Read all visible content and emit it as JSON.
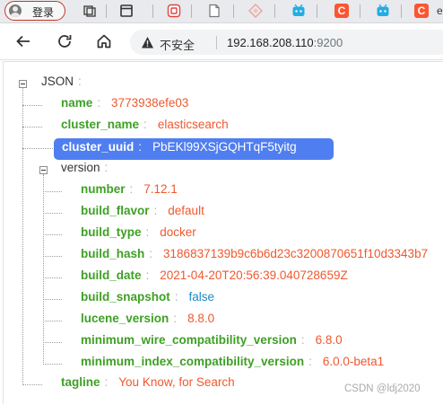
{
  "browser": {
    "login_label": "登录",
    "tabs": [
      {
        "icon": "cube-icon"
      },
      {
        "icon": "tab-square-icon"
      },
      {
        "icon": "red-badge-icon"
      },
      {
        "icon": "blank-page-icon"
      },
      {
        "icon": "diamond-icon"
      },
      {
        "icon": "bilibili-tv-icon"
      },
      {
        "icon": "csdn-icon",
        "letter": "C"
      },
      {
        "icon": "bilibili-tv-icon"
      },
      {
        "icon": "csdn-icon",
        "letter": "C"
      },
      {
        "icon": "partial-tab",
        "letter": "e"
      }
    ],
    "insecure_label": "不安全",
    "url_host": "192.168.208.110",
    "url_port": ":9200",
    "colors": {
      "csdn": "#fc5531",
      "bilibili": "#23ade5",
      "key": "#3ea024",
      "string": "#f0582e",
      "bool": "#1a8bc7",
      "highlight": "#4f7ef0"
    }
  },
  "json_viewer": {
    "root_label": "JSON",
    "fields": {
      "name": {
        "key": "name",
        "value": "3773938efe03"
      },
      "cluster_name": {
        "key": "cluster_name",
        "value": "elasticsearch"
      },
      "cluster_uuid": {
        "key": "cluster_uuid",
        "value": "PbEKl99XSjGQHTqF5tyitg"
      },
      "version": {
        "key": "version"
      },
      "tagline": {
        "key": "tagline",
        "value": "You Know, for Search"
      }
    },
    "version_fields": [
      {
        "key": "number",
        "value": "7.12.1"
      },
      {
        "key": "build_flavor",
        "value": "default"
      },
      {
        "key": "build_type",
        "value": "docker"
      },
      {
        "key": "build_hash",
        "value": "3186837139b9c6b6d23c3200870651f10d3343b7"
      },
      {
        "key": "build_date",
        "value": "2021-04-20T20:56:39.040728659Z"
      },
      {
        "key": "build_snapshot",
        "value": "false"
      },
      {
        "key": "lucene_version",
        "value": "8.8.0"
      },
      {
        "key": "minimum_wire_compatibility_version",
        "value": "6.8.0"
      },
      {
        "key": "minimum_index_compatibility_version",
        "value": "6.0.0-beta1"
      }
    ]
  },
  "watermark": "CSDN @ldj2020"
}
